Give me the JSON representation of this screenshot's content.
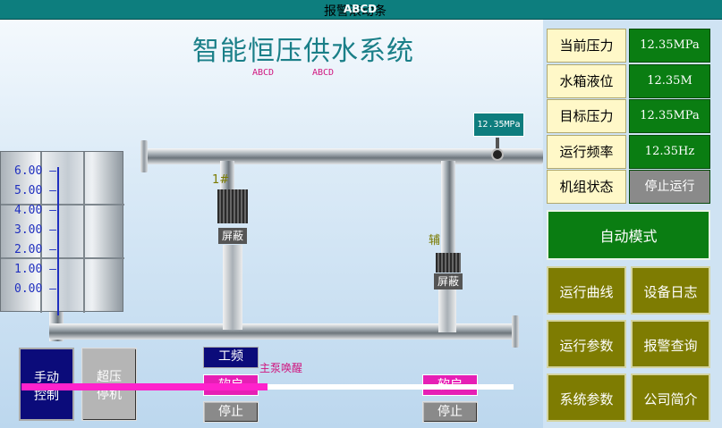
{
  "titlebar": {
    "marquee": "报警滚动条",
    "overlay": "ABCD"
  },
  "scene": {
    "title": "智能恒压供水系统",
    "abcd_left": "ABCD",
    "abcd_right": "ABCD",
    "tank_scale": [
      "6.00",
      "5.00",
      "4.00",
      "3.00",
      "2.00",
      "1.00",
      "0.00"
    ],
    "gauge_reading": "12.35MPa",
    "pump1": {
      "tag": "1#",
      "mask": "屏蔽"
    },
    "pump_aux": {
      "tag": "辅",
      "mask": "屏蔽"
    },
    "wake_text": "主泵唤醒",
    "progress_fraction": 0.5
  },
  "controls": {
    "manual_line1": "手动",
    "manual_line2": "控制",
    "overpressure_line1": "超压",
    "overpressure_line2": "停机",
    "pump1_mode": "工频",
    "pump1_start": "软启",
    "pump1_stop": "停止",
    "aux_start": "软启",
    "aux_stop": "停止"
  },
  "panel": {
    "rows": [
      {
        "label": "当前压力",
        "value": "12.35MPa"
      },
      {
        "label": "水箱液位",
        "value": "12.35M"
      },
      {
        "label": "目标压力",
        "value": "12.35MPa"
      },
      {
        "label": "运行频率",
        "value": "12.35Hz"
      },
      {
        "label": "机组状态",
        "value": "停止运行"
      }
    ],
    "auto_mode": "自动模式",
    "menu": [
      "运行曲线",
      "设备日志",
      "运行参数",
      "报警查询",
      "系统参数",
      "公司简介"
    ]
  },
  "colors": {
    "title_bar": "#0d7e7e",
    "value_green": "#0a7d12",
    "menu_olive": "#7e7c02",
    "accent_magenta": "#e61fb5"
  }
}
